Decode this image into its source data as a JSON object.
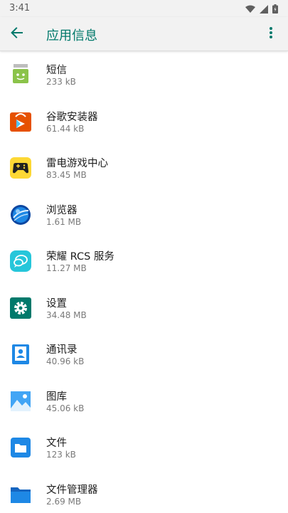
{
  "status_bar": {
    "time": "3:41",
    "icons": [
      "wifi-icon",
      "signal-icon",
      "battery-icon"
    ]
  },
  "app_bar": {
    "title": "应用信息",
    "back_icon": "arrow-back-icon",
    "menu_icon": "more-vert-icon",
    "accent": "#00796b"
  },
  "apps": [
    {
      "name": "短信",
      "size": "233 kB",
      "icon": "sms-icon"
    },
    {
      "name": "谷歌安装器",
      "size": "61.44 kB",
      "icon": "google-installer-icon"
    },
    {
      "name": "雷电游戏中心",
      "size": "83.45 MB",
      "icon": "game-center-icon"
    },
    {
      "name": "浏览器",
      "size": "1.61 MB",
      "icon": "browser-icon"
    },
    {
      "name": "荣耀 RCS 服务",
      "size": "11.27 MB",
      "icon": "rcs-service-icon"
    },
    {
      "name": "设置",
      "size": "34.48 MB",
      "icon": "settings-icon"
    },
    {
      "name": "通讯录",
      "size": "40.96 kB",
      "icon": "contacts-icon"
    },
    {
      "name": "图库",
      "size": "45.06 kB",
      "icon": "gallery-icon"
    },
    {
      "name": "文件",
      "size": "123 kB",
      "icon": "files-icon"
    },
    {
      "name": "文件管理器",
      "size": "2.69 MB",
      "icon": "file-manager-icon"
    }
  ]
}
